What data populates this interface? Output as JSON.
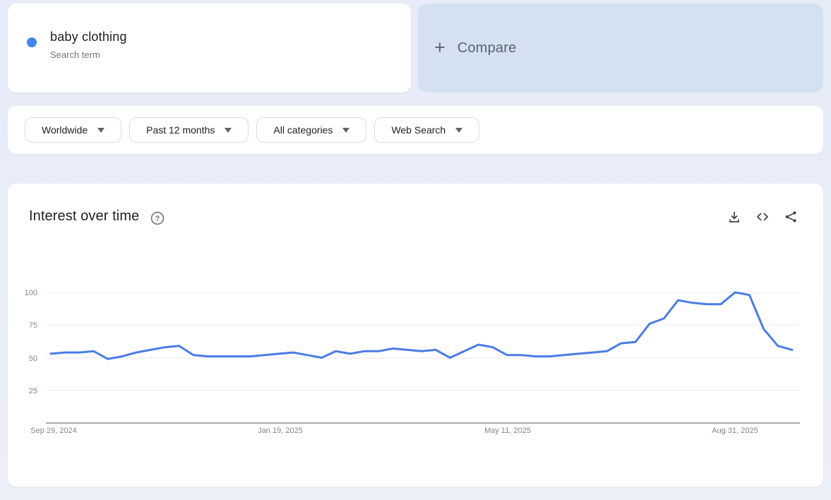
{
  "term_card": {
    "term": "baby clothing",
    "type_label": "Search term",
    "dot_color": "#4285f4"
  },
  "compare_card": {
    "plus_glyph": "+",
    "label": "Compare",
    "bg_color": "#d3e1f3"
  },
  "filters": [
    {
      "id": "region",
      "label": "Worldwide"
    },
    {
      "id": "time",
      "label": "Past 12 months"
    },
    {
      "id": "category",
      "label": "All categories"
    },
    {
      "id": "search-type",
      "label": "Web Search"
    }
  ],
  "chart_section": {
    "title": "Interest over time",
    "help_icon": "help-icon",
    "action_icons": [
      "download-icon",
      "embed-code-icon",
      "share-icon"
    ]
  },
  "chart_data": {
    "type": "line",
    "title": "Interest over time",
    "series": [
      {
        "name": "baby clothing",
        "color": "#4a7ce6",
        "values": [
          53,
          54,
          54,
          55,
          49,
          51,
          54,
          56,
          58,
          59,
          52,
          51,
          51,
          51,
          51,
          52,
          53,
          54,
          52,
          50,
          55,
          53,
          55,
          55,
          57,
          56,
          55,
          56,
          50,
          55,
          60,
          58,
          52,
          52,
          51,
          51,
          52,
          53,
          54,
          55,
          61,
          62,
          76,
          80,
          94,
          92,
          91,
          91,
          100,
          98,
          72,
          59,
          56
        ]
      }
    ],
    "x_tick_labels": [
      "Sep 29, 2024",
      "Jan 19, 2025",
      "May 11, 2025",
      "Aug 31, 2025"
    ],
    "y_tick_labels": [
      "100",
      "75",
      "50",
      "25"
    ],
    "y_ticks": [
      100,
      75,
      50,
      25
    ],
    "ylim": [
      0,
      100
    ],
    "x_unit": "weekly",
    "grid": "horizontal",
    "legend": "none"
  },
  "colors": {
    "page_bg": "#e9edf7",
    "card_bg": "#ffffff",
    "compare_bg": "#d3e1f3",
    "grid_line": "#e8e8e8",
    "axis_line": "#757575",
    "text_primary": "#202124",
    "text_secondary": "#5f6368",
    "tick_label": "#80868b",
    "pill_border": "#dadce0",
    "icon_gray": "#3c4043"
  }
}
